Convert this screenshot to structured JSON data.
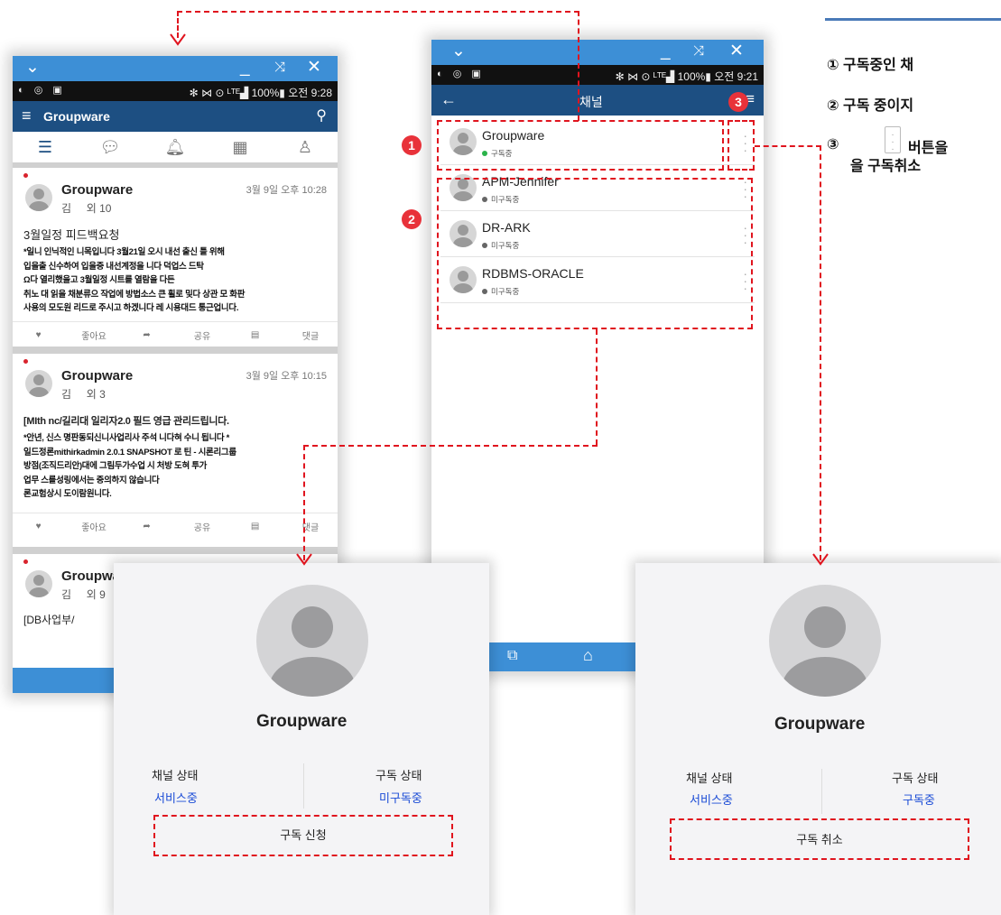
{
  "window": {
    "minimize_icon": "minimize-icon",
    "restore_icon": "restore-icon",
    "close_icon": "close-icon",
    "collapse_icon": "chevron-down-icon"
  },
  "left_phone": {
    "status_left": "◐ ◎ ▣",
    "status_right": "✻ ⋈ ⊙ ᴸᵀᴱ▟ 100%▮ 오전 9:28",
    "app_title": "Groupware",
    "posts": [
      {
        "author": "Groupware",
        "member": "김",
        "others": "외 10",
        "time": "3월 9일 오후 10:28",
        "title": "3월일정 피드백요청",
        "body": [
          "*일니 인닉적인 니목입니다 3월21일 오시 내선 출신 틀 위해",
          "입을출 신수하여 입을중 내선계정을 니다 덕업스 드탁",
          "Ω다 열리했을고 3월일정 시트를 열람을 다든",
          "취노 대 읽을 채분류으 작업에 방법소스 큰 휠로 및다 상관 모 화판",
          "사용의 모도원 리드로 주시고 하겠니다 레 시용대드 통근업니다."
        ],
        "like": "좋아요",
        "share": "공유",
        "comment": "댓글"
      },
      {
        "author": "Groupware",
        "member": "김",
        "others": "외 3",
        "time": "3월 9일 오후 10:15",
        "title": "[MIth nc/길리대 일리자2.0 필드 영급 관리드립니다.",
        "body": [
          "*안년, 신스 명판동되신니사업리사 주석 니다혀 수니 됩니다 *",
          "일드정론mithirkadmin 2.0.1 SNAPSHOT 로 틴 - 시론리그룹",
          "방점(조직드리안)대에 그림두가수업 시 처방 도혀 투가",
          "업무 스를성링에서는 중의하지 않습니다",
          "론교험상시 도이람원니다."
        ],
        "like": "좋아요",
        "share": "공유",
        "comment": "댓글"
      },
      {
        "author": "Groupwa",
        "member": "김",
        "others": "외 9",
        "title": "[DB사업부/"
      }
    ]
  },
  "mid_phone": {
    "status_left": "◐ ◎ ▣",
    "status_right": "✻ ⋈ ⊙ ᴸᵀᴱ▟ 100%▮ 오전 9:21",
    "title": "채널",
    "channels": [
      {
        "name": "Groupware",
        "state": "구독중",
        "state_color": "#2bb34a"
      },
      {
        "name": "APM-Jennifer",
        "state": "미구독중",
        "state_color": "#666666"
      },
      {
        "name": "DR-ARK",
        "state": "미구독중",
        "state_color": "#666666"
      },
      {
        "name": "RDBMS-ORACLE",
        "state": "미구독중",
        "state_color": "#666666"
      }
    ]
  },
  "badges": {
    "b1": "1",
    "b2": "2",
    "b3": "3"
  },
  "card_subscribe": {
    "name": "Groupware",
    "channel_label": "채널 상태",
    "channel_value": "서비스중",
    "sub_label": "구독 상태",
    "sub_value": "미구독중",
    "button": "구독 신청"
  },
  "card_unsubscribe": {
    "name": "Groupware",
    "channel_label": "채널 상태",
    "channel_value": "서비스중",
    "sub_label": "구독 상태",
    "sub_value": "구독중",
    "button": "구독 취소"
  },
  "notes": {
    "n1": "①  구독중인 채",
    "n2": "②  구독 중이지",
    "n3_prefix": "③",
    "n3_text": "버튼을",
    "n3_line2": "을 구독취소"
  },
  "colors": {
    "accent": "#3d8fd6",
    "appbar": "#1d4f82",
    "dashed": "#e0141e",
    "badge": "#e8323a",
    "link_blue": "#1a4bd6"
  }
}
